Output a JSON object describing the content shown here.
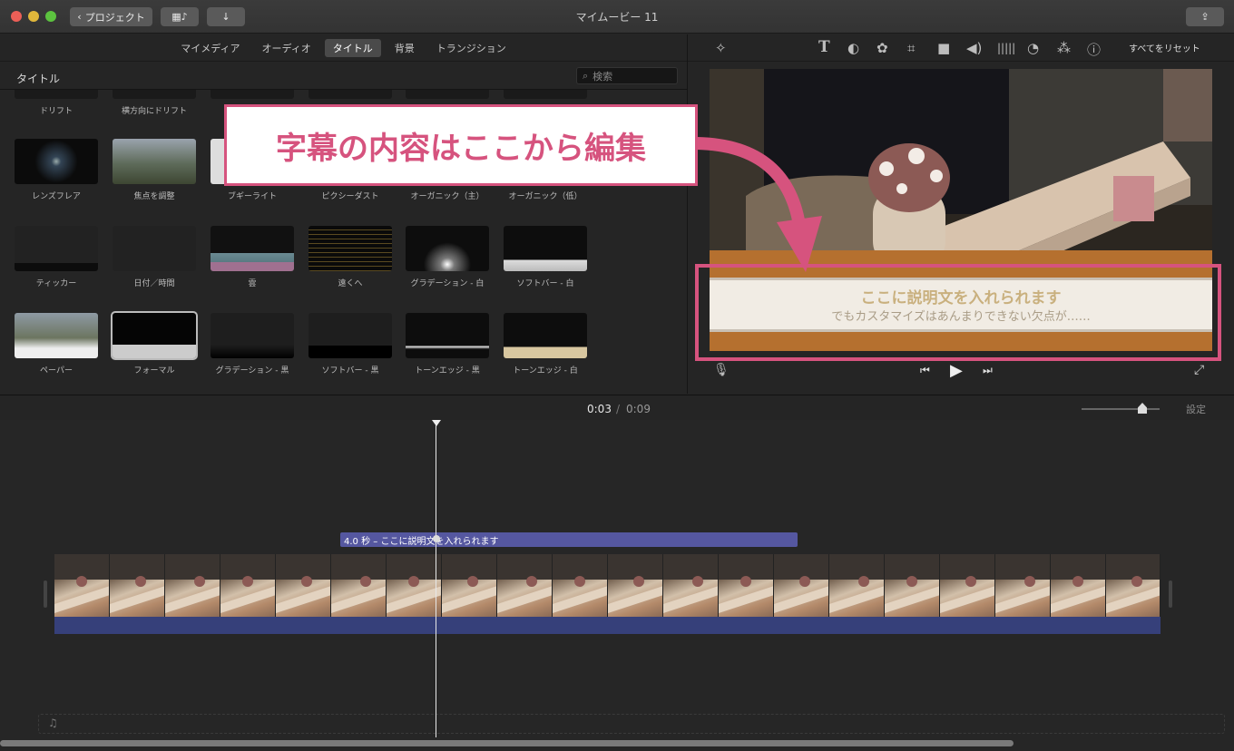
{
  "window": {
    "title": "マイムービー 11"
  },
  "toolbar": {
    "back_label": "プロジェクト",
    "share_icon": "share-icon"
  },
  "browser": {
    "tabs": [
      {
        "label": "マイメディア",
        "active": false
      },
      {
        "label": "オーディオ",
        "active": false
      },
      {
        "label": "タイトル",
        "active": true
      },
      {
        "label": "背景",
        "active": false
      },
      {
        "label": "トランジション",
        "active": false
      }
    ],
    "section_title": "タイトル",
    "search_placeholder": "検索",
    "titles": [
      {
        "label": "ドリフト"
      },
      {
        "label": "横方向にドリフト"
      },
      {
        "label": "レンズフレア"
      },
      {
        "label": "焦点を調整"
      },
      {
        "label": "ブギーライト"
      },
      {
        "label": "ピクシーダスト"
      },
      {
        "label": "オーガニック（主）"
      },
      {
        "label": "オーガニック（低）"
      },
      {
        "label": "ティッカー"
      },
      {
        "label": "日付／時間"
      },
      {
        "label": "雲"
      },
      {
        "label": "遠くへ"
      },
      {
        "label": "グラデーション - 白"
      },
      {
        "label": "ソフトバー - 白"
      },
      {
        "label": "ペーパー"
      },
      {
        "label": "フォーマル"
      },
      {
        "label": "グラデーション - 黒"
      },
      {
        "label": "ソフトバー - 黒"
      },
      {
        "label": "トーンエッジ - 黒"
      },
      {
        "label": "トーンエッジ - 白"
      }
    ]
  },
  "viewer": {
    "reset_label": "すべてをリセット",
    "subtitle_line1": "ここに説明文を入れられます",
    "subtitle_line2": "でもカスタマイズはあんまりできない欠点が……"
  },
  "timeline": {
    "current_time": "0:03",
    "total_time": "0:09",
    "settings_label": "設定",
    "title_clip_label": "4.0 秒 – ここに説明文を入れられます"
  },
  "annotation": {
    "callout_text": "字幕の内容はここから編集",
    "accent_color": "#d6537e"
  }
}
